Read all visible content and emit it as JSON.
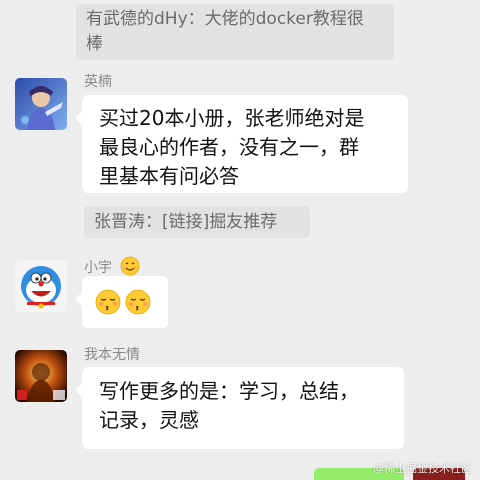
{
  "messages": {
    "quote_top": {
      "line1": "有武德的dHy：大佬的docker教程很",
      "line2": "棒"
    },
    "m1": {
      "sender": "英楠",
      "line1": "买过20本小册，张老师绝对是",
      "line2": "最良心的作者，没有之一，群",
      "line3": "里基本有问必答"
    },
    "quote_mid": {
      "text": "张晋涛：[链接]掘友推荐"
    },
    "m2": {
      "sender": "小宇",
      "sender_emoji": "smiling-face-icon",
      "content_emoji": "kissing-face-icon"
    },
    "m3": {
      "sender": "我本无情",
      "line1": "写作更多的是：学习，总结，",
      "line2": "记录，灵感"
    }
  },
  "watermark": "@稀土掘金技术社区",
  "colors": {
    "background": "#ededed",
    "bubble_white": "#ffffff",
    "bubble_quote": "#e2e2e2",
    "bubble_self": "#95ec69",
    "name_gray": "#8a8a8a"
  }
}
